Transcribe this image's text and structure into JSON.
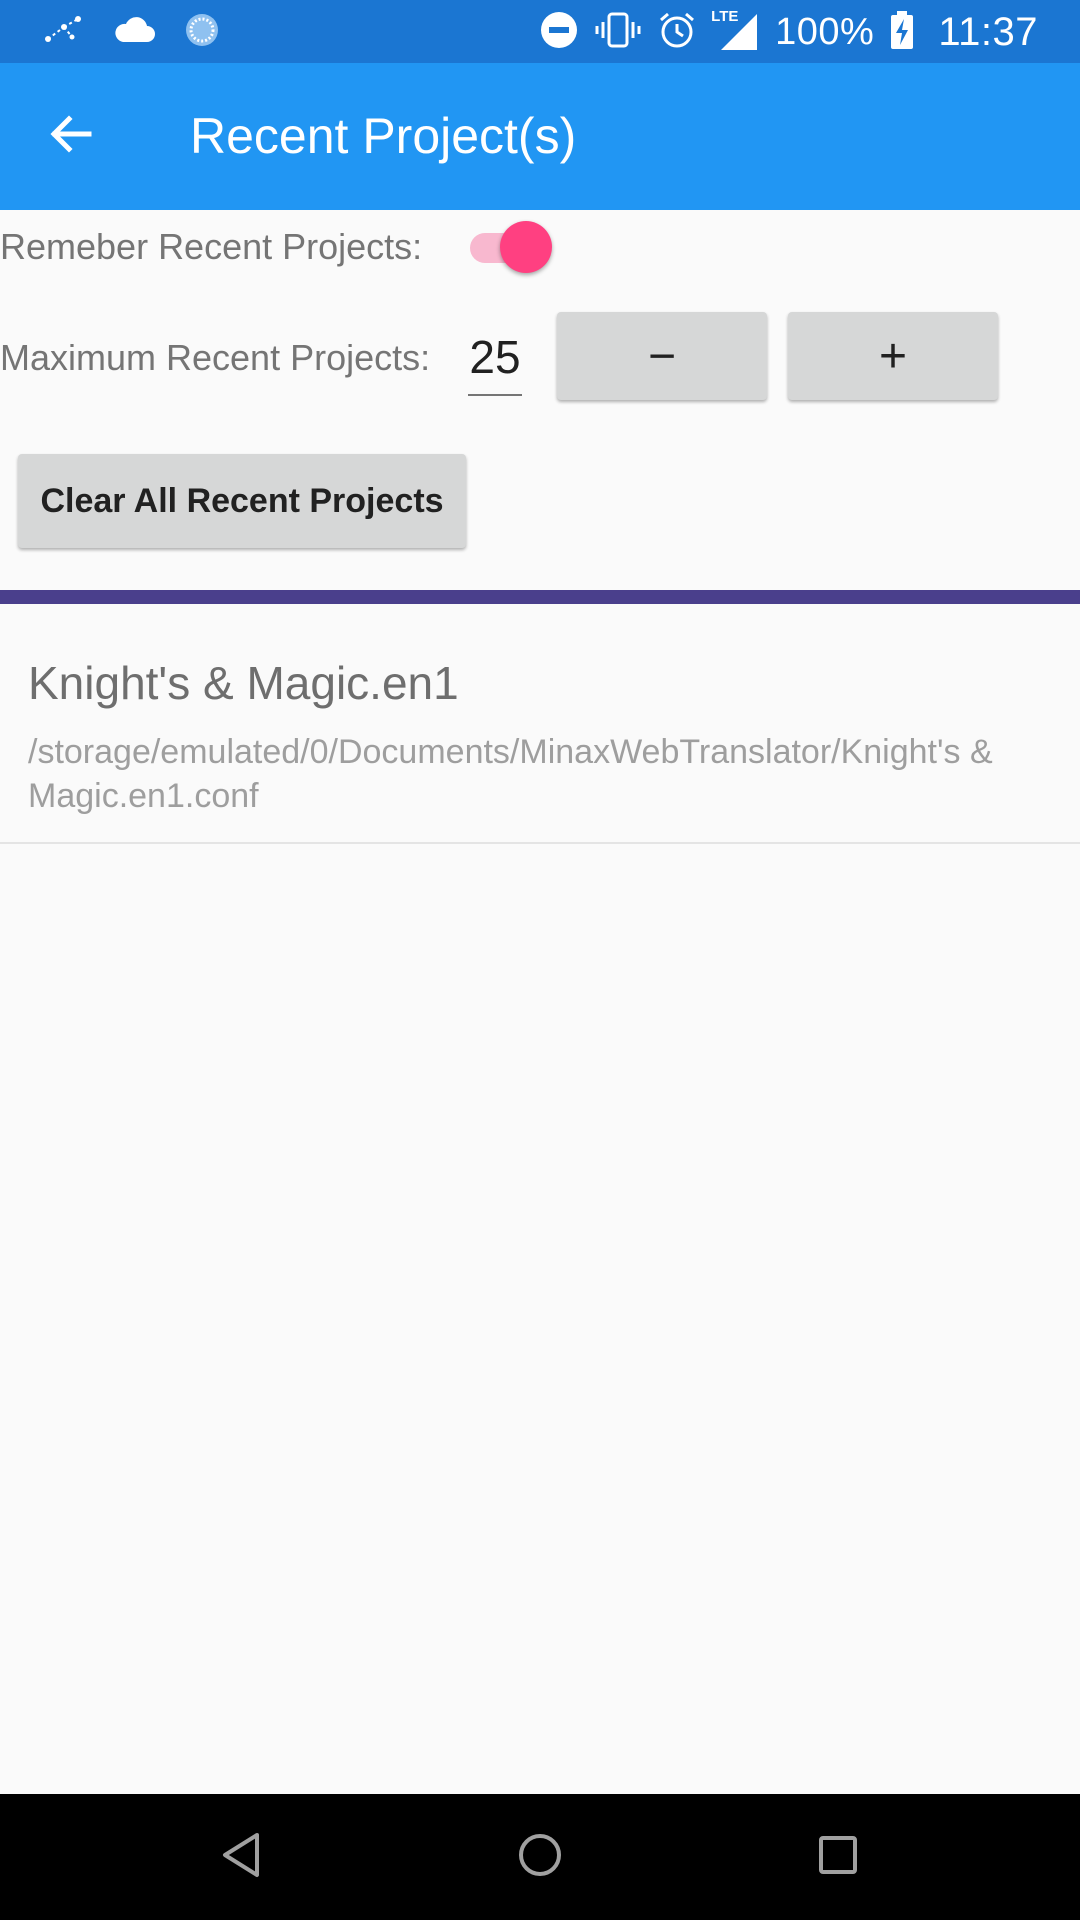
{
  "status_bar": {
    "battery": "100%",
    "time": "11:37",
    "network": "LTE",
    "icons": [
      "constellation-icon",
      "cloud-icon",
      "sync-icon",
      "do-not-disturb-icon",
      "vibrate-icon",
      "alarm-icon",
      "signal-icon",
      "battery-charging-icon"
    ]
  },
  "app_bar": {
    "title": "Recent Project(s)",
    "color": "#2196f3"
  },
  "settings": {
    "remember_label": "Remeber Recent Projects:",
    "remember_enabled": true,
    "max_label": "Maximum Recent Projects:",
    "max_value": "25",
    "decrement_label": "−",
    "increment_label": "+",
    "clear_button_label": "Clear All Recent Projects"
  },
  "recent_projects": [
    {
      "name": "Knight's & Magic.en1",
      "path": "/storage/emulated/0/Documents/MinaxWebTranslator/Knight's & Magic.en1.conf"
    }
  ],
  "colors": {
    "status_bar": "#1b76d2",
    "accent": "#ff4081",
    "divider": "#4a3f8c"
  }
}
